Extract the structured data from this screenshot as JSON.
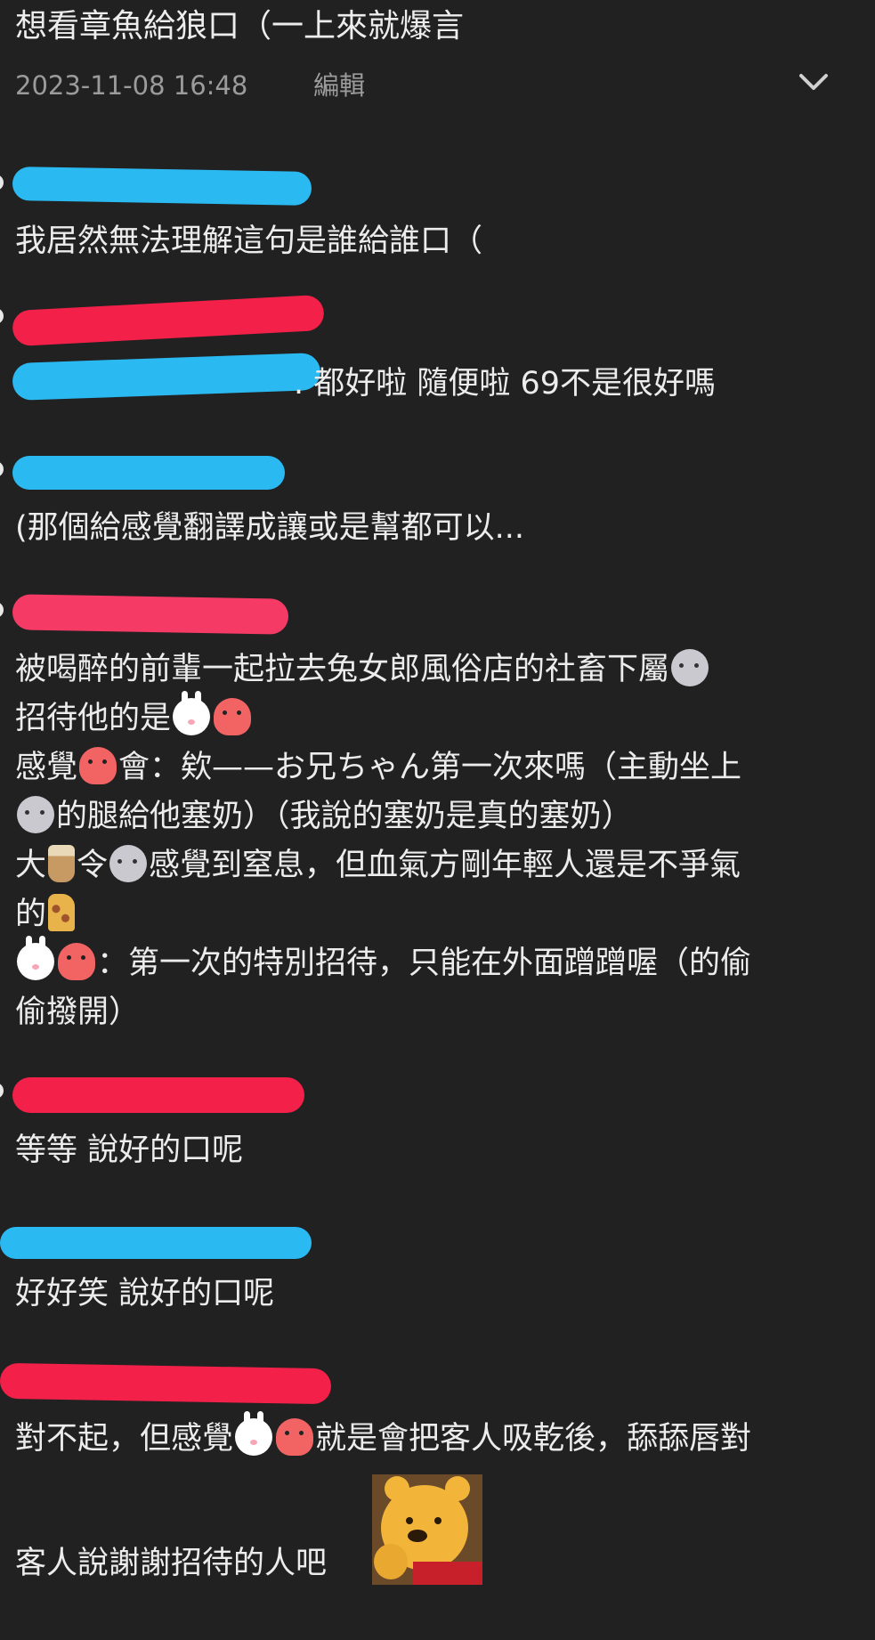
{
  "post": {
    "title": "想看章魚給狼口（一上來就爆言",
    "datetime": "2023-11-08 16:48",
    "edit_label": "編輯",
    "expand_icon": "chevron-down-icon"
  },
  "colors": {
    "background": "#212121",
    "text": "#ececec",
    "meta": "#9b9b9b",
    "redact_blue": "#2bb9f2",
    "redact_red": "#f3204a",
    "mention": "#6ec9f7"
  },
  "comments": [
    {
      "lines": [
        "我居然無法理解這句是誰給誰口（"
      ]
    },
    {
      "reply_tail": ". 都好啦 隨便啦 69不是很好嗎"
    },
    {
      "lines": [
        "(那個給感覺翻譯成讓或是幫都可以..."
      ]
    },
    {
      "l1": "被喝醉的前輩一起拉去兔女郎風俗店的社畜下屬",
      "l2": "招待他的是",
      "l3a": "感覺",
      "l3b": "會：欸——お兄ちゃん第一次來嗎（主動坐上",
      "l4": "的腿給他塞奶）（我說的塞奶是真的塞奶）",
      "l5a": "大",
      "l5b": "令",
      "l5c": "感覺到窒息，但血氣方剛年輕人還是不爭氣",
      "l6": "的",
      "l7": "：第一次的特別招待，只能在外面蹭蹭喔（的偷",
      "l8": "偷撥開）",
      "emoji": [
        "wolf",
        "rabbit",
        "octopus",
        "bubble-tea",
        "giraffe"
      ]
    },
    {
      "lines": [
        "等等 說好的口呢"
      ]
    },
    {
      "lines": [
        "好好笑 說好的口呢"
      ]
    },
    {
      "l1a": "對不起，但感覺",
      "l1b": "就是會把客人吸乾後，舔舔唇對",
      "l2": "客人說謝謝招待的人吧",
      "sticker": "winnie-the-pooh-sticker"
    }
  ]
}
